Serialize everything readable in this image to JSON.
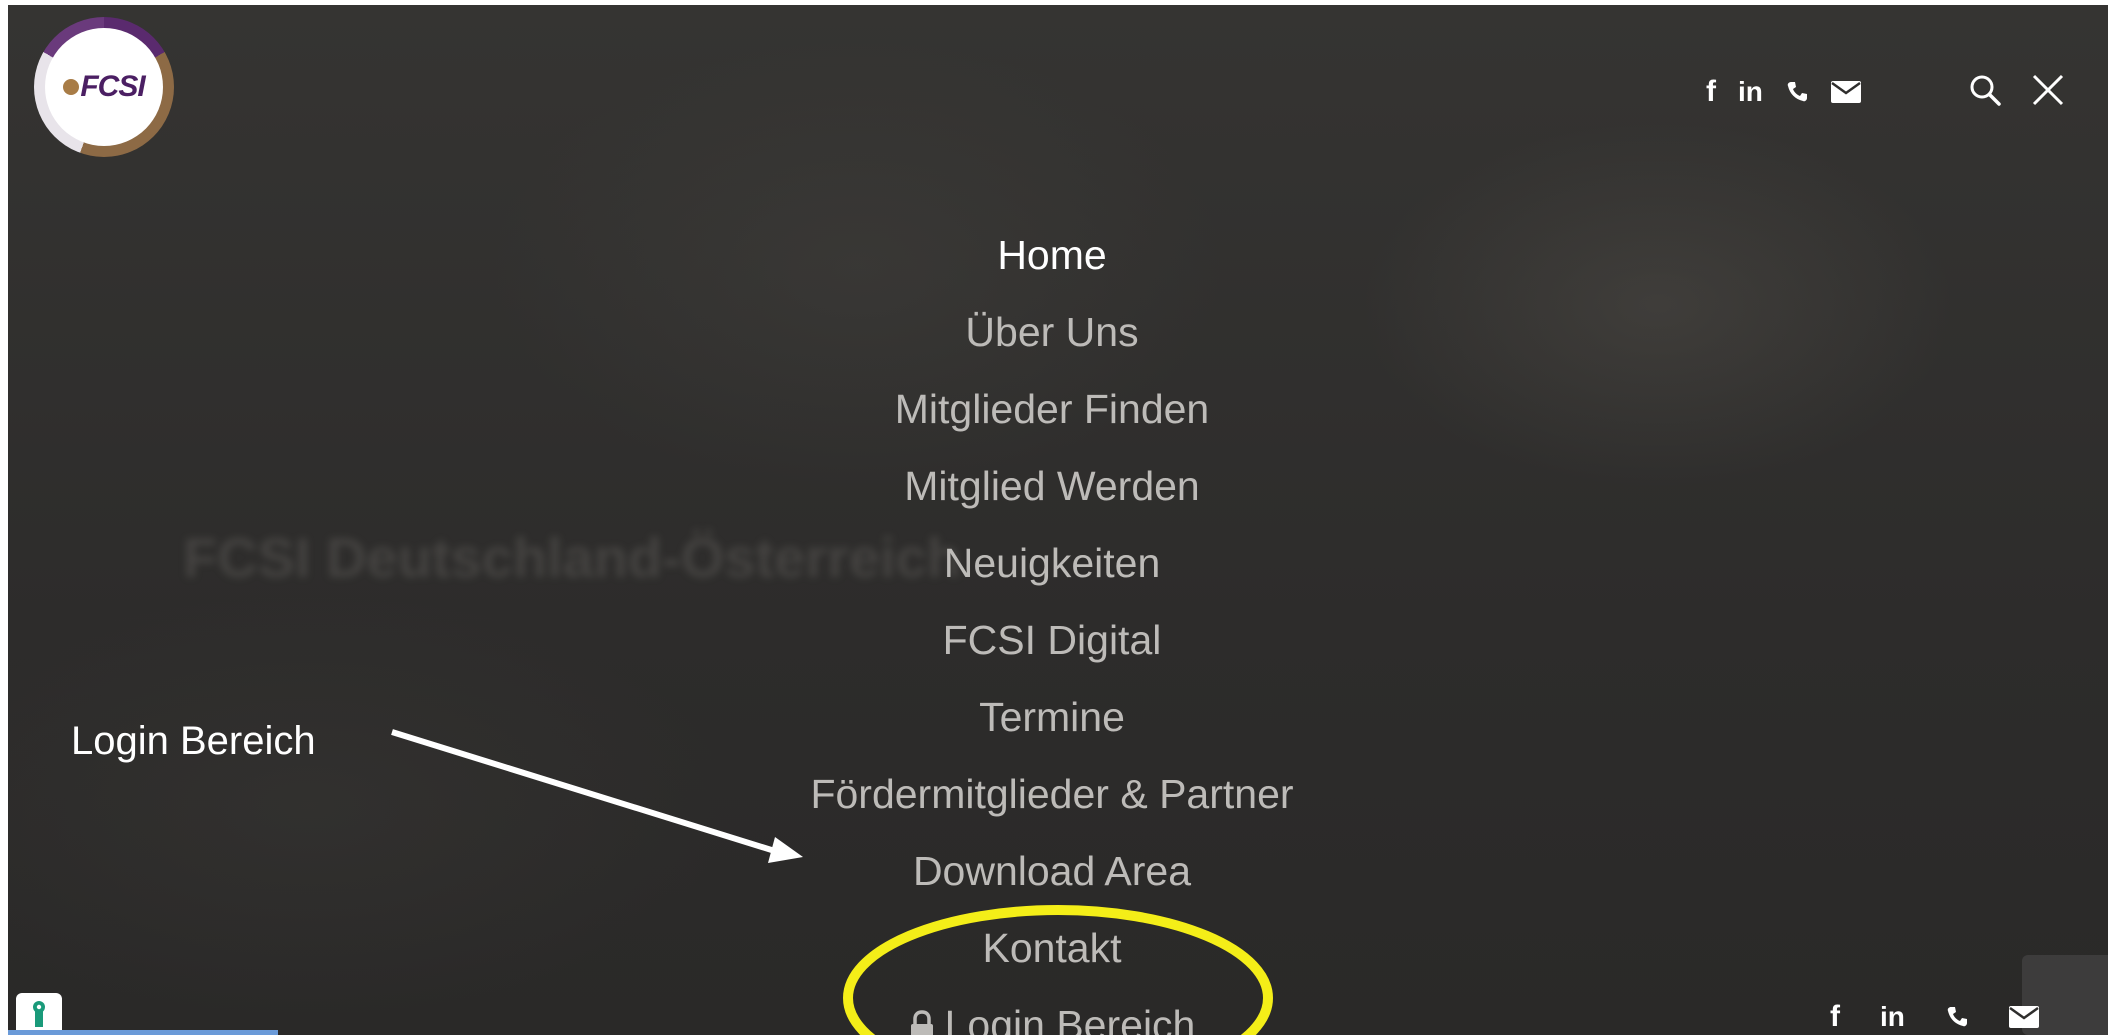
{
  "brand": {
    "logo_text": "FCSI"
  },
  "background": {
    "headline": "FCSI Deutschland-Österreich"
  },
  "header": {
    "social_icons": [
      "facebook-icon",
      "linkedin-icon",
      "phone-icon",
      "mail-icon"
    ],
    "facebook_label": "f",
    "linkedin_label": "in"
  },
  "nav": {
    "items": [
      {
        "label": "Home"
      },
      {
        "label": "Über Uns"
      },
      {
        "label": "Mitglieder Finden"
      },
      {
        "label": "Mitglied Werden"
      },
      {
        "label": "Neuigkeiten"
      },
      {
        "label": "FCSI Digital"
      },
      {
        "label": "Termine"
      },
      {
        "label": "Fördermitglieder & Partner"
      },
      {
        "label": "Download Area"
      },
      {
        "label": "Kontakt"
      },
      {
        "label": "Login Bereich"
      }
    ],
    "active_index": 0
  },
  "annotation": {
    "label": "Login Bereich",
    "arrow_color": "#ffffff",
    "highlight_color": "#f4ee18"
  },
  "footer": {
    "facebook_label": "f",
    "linkedin_label": "in"
  },
  "colors": {
    "overlay": "#2f2e2d",
    "nav_active": "#ffffff",
    "nav_inactive": "#bdbbb8",
    "logo_purple": "#4b1f63"
  }
}
